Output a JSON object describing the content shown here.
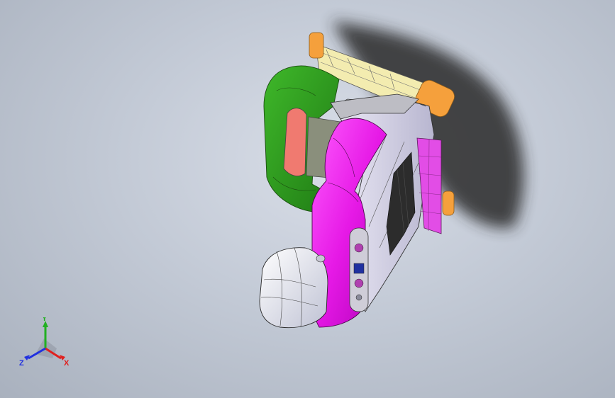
{
  "viewport": {
    "background_top": "#d9dee8",
    "background_bottom": "#a9b1be"
  },
  "model": {
    "parts": [
      {
        "name": "green-frame",
        "color": "#2e9e1e"
      },
      {
        "name": "magenta-cover",
        "color": "#e619e6"
      },
      {
        "name": "white-housing",
        "color": "#f2f2f6"
      },
      {
        "name": "salmon-panel",
        "color": "#f07a70"
      },
      {
        "name": "orange-wheel",
        "color": "#f5a03c"
      },
      {
        "name": "yellow-rail",
        "color": "#f3ecb0"
      },
      {
        "name": "dark-grille",
        "color": "#2c2c2c"
      }
    ]
  },
  "triad": {
    "x_label": "X",
    "y_label": "Y",
    "z_label": "Z",
    "x_color": "#e0201e",
    "y_color": "#22b022",
    "z_color": "#2030e0"
  }
}
